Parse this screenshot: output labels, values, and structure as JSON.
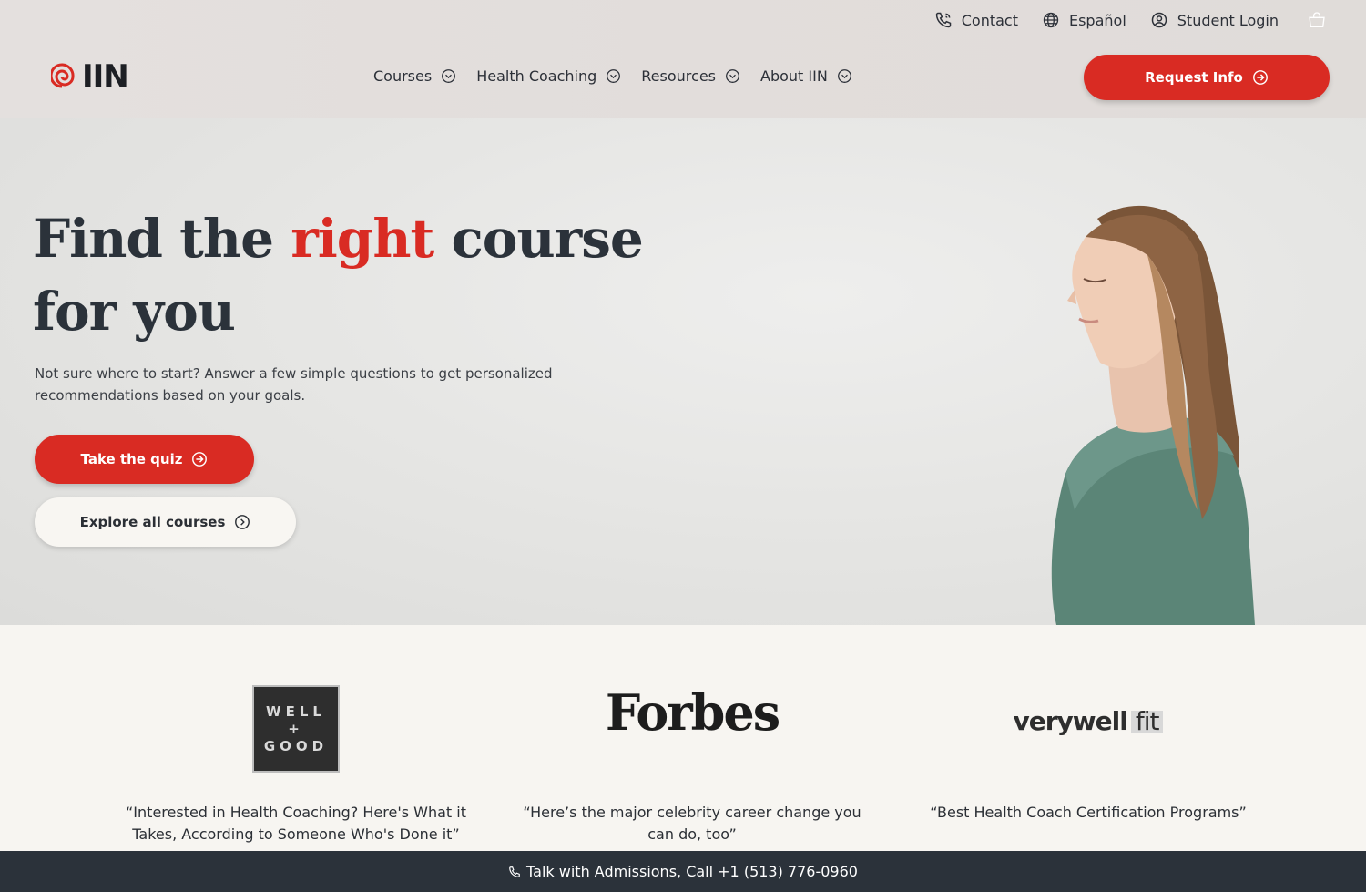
{
  "header": {
    "utility": {
      "contact": "Contact",
      "language": "Español",
      "login": "Student Login"
    },
    "logo_text": "IIN",
    "nav": [
      {
        "label": "Courses"
      },
      {
        "label": "Health Coaching"
      },
      {
        "label": "Resources"
      },
      {
        "label": "About IIN"
      }
    ],
    "request_button": "Request Info"
  },
  "hero": {
    "headline_part1": "Find the ",
    "headline_accent": "right",
    "headline_part2": " course for you",
    "subtext": "Not sure where to start? Answer a few simple questions to get personalized recommendations based on your goals.",
    "quiz_button": "Take the quiz",
    "explore_button": "Explore all courses"
  },
  "press": [
    {
      "logo_lines": [
        "WELL",
        "+",
        "GOOD"
      ],
      "quote": "“Interested in Health Coaching? Here's What it Takes, According to Someone Who's Done it”"
    },
    {
      "logo": "Forbes",
      "quote": "“Here’s the major celebrity career change you can do, too”"
    },
    {
      "logo_main": "verywell",
      "logo_accent": "fit",
      "quote": "“Best Health Coach Certification Programs”"
    }
  ],
  "bottom_bar": {
    "text": "Talk with Admissions, Call +1 (513) 776-0960"
  },
  "colors": {
    "brand_red": "#d92b23",
    "dark": "#2b323a"
  }
}
